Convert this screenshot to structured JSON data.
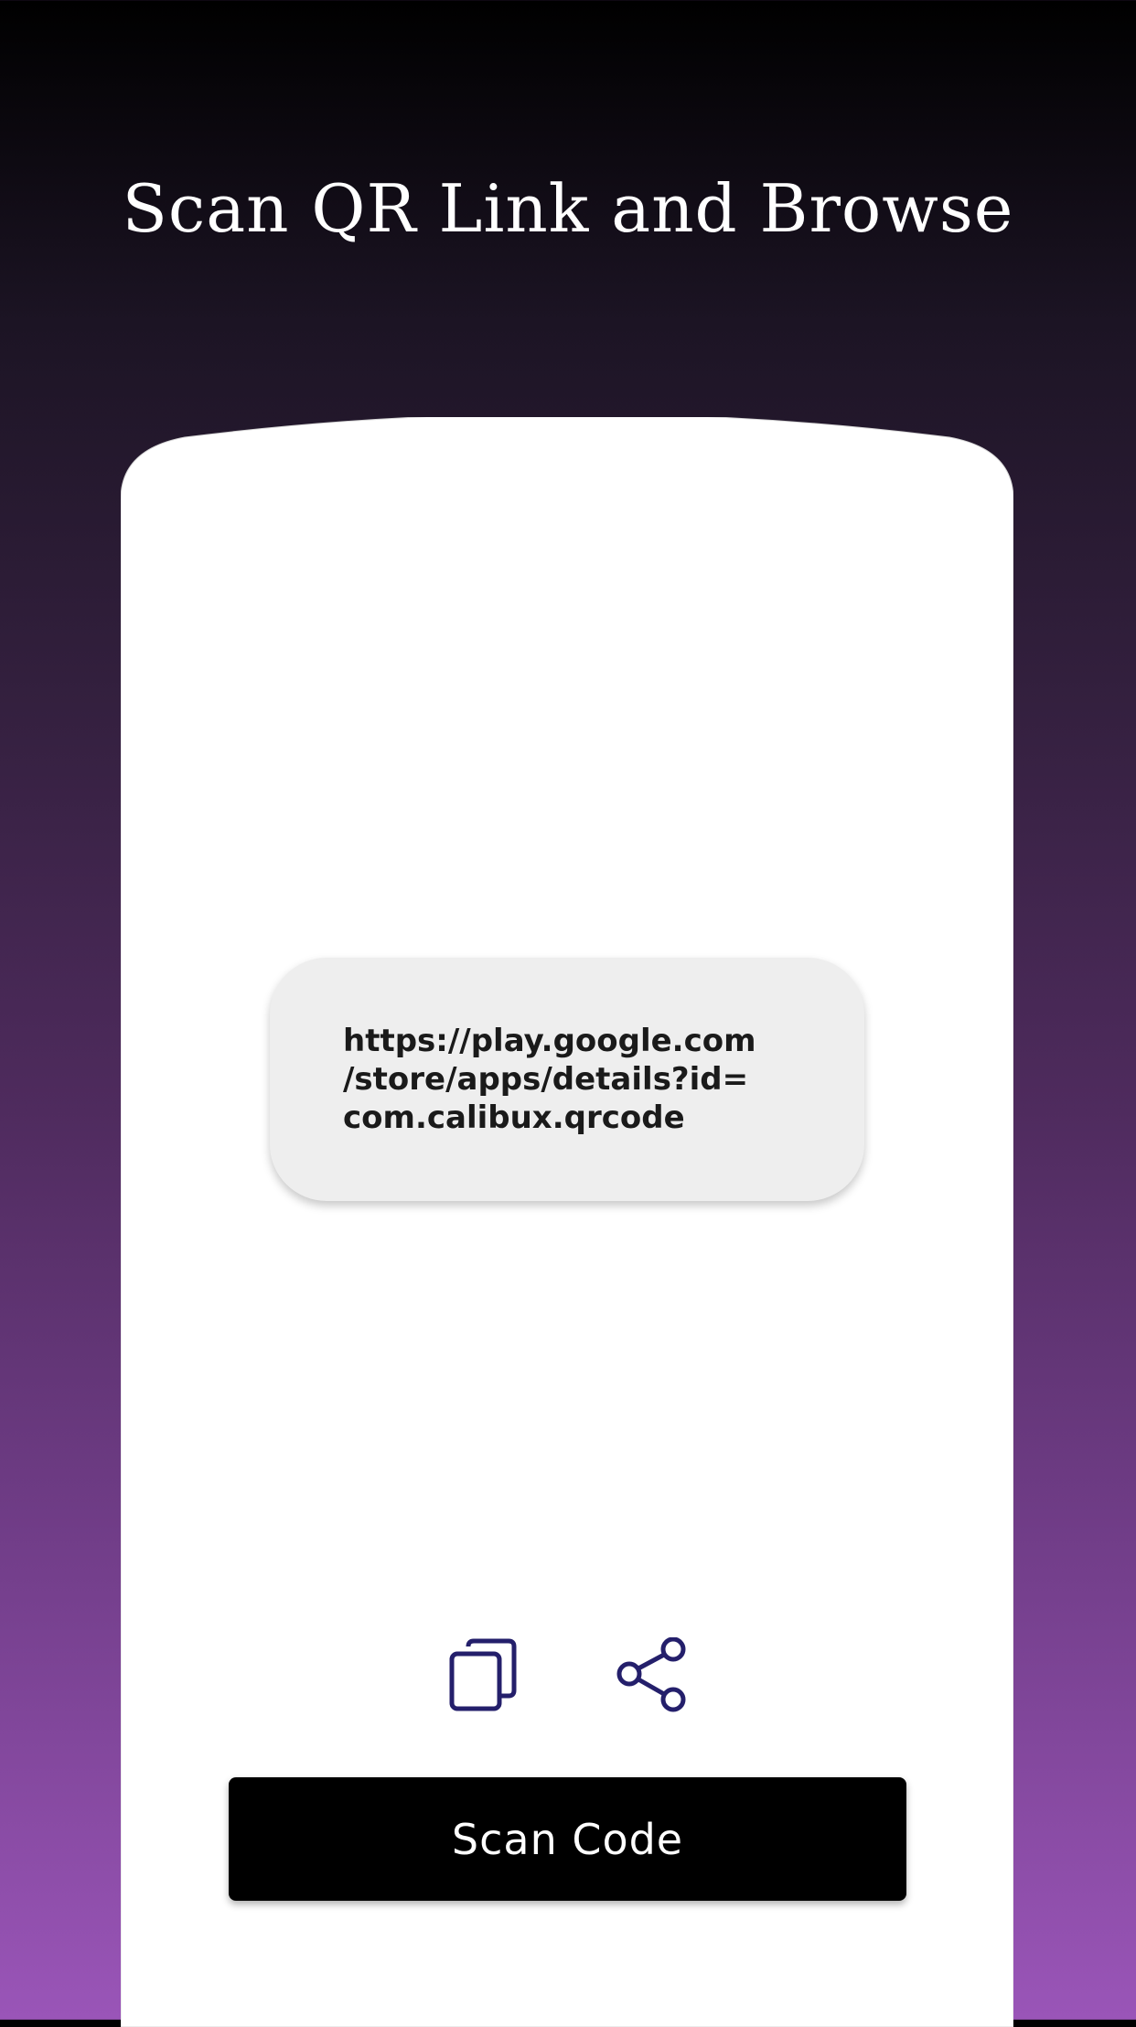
{
  "header": {
    "title": "Scan QR Link and Browse"
  },
  "result": {
    "text": "https://play.google.com\n/store/apps/details?id=\ncom.calibux.qrcode"
  },
  "actions": {
    "copy_icon": "copy-icon",
    "share_icon": "share-icon"
  },
  "scan_button": {
    "label": "Scan Code"
  },
  "colors": {
    "icon": "#241f6b",
    "card": "#ffffff",
    "result_box": "#eeeeee",
    "button": "#000000",
    "gradient_bottom": "#9a55b8"
  }
}
